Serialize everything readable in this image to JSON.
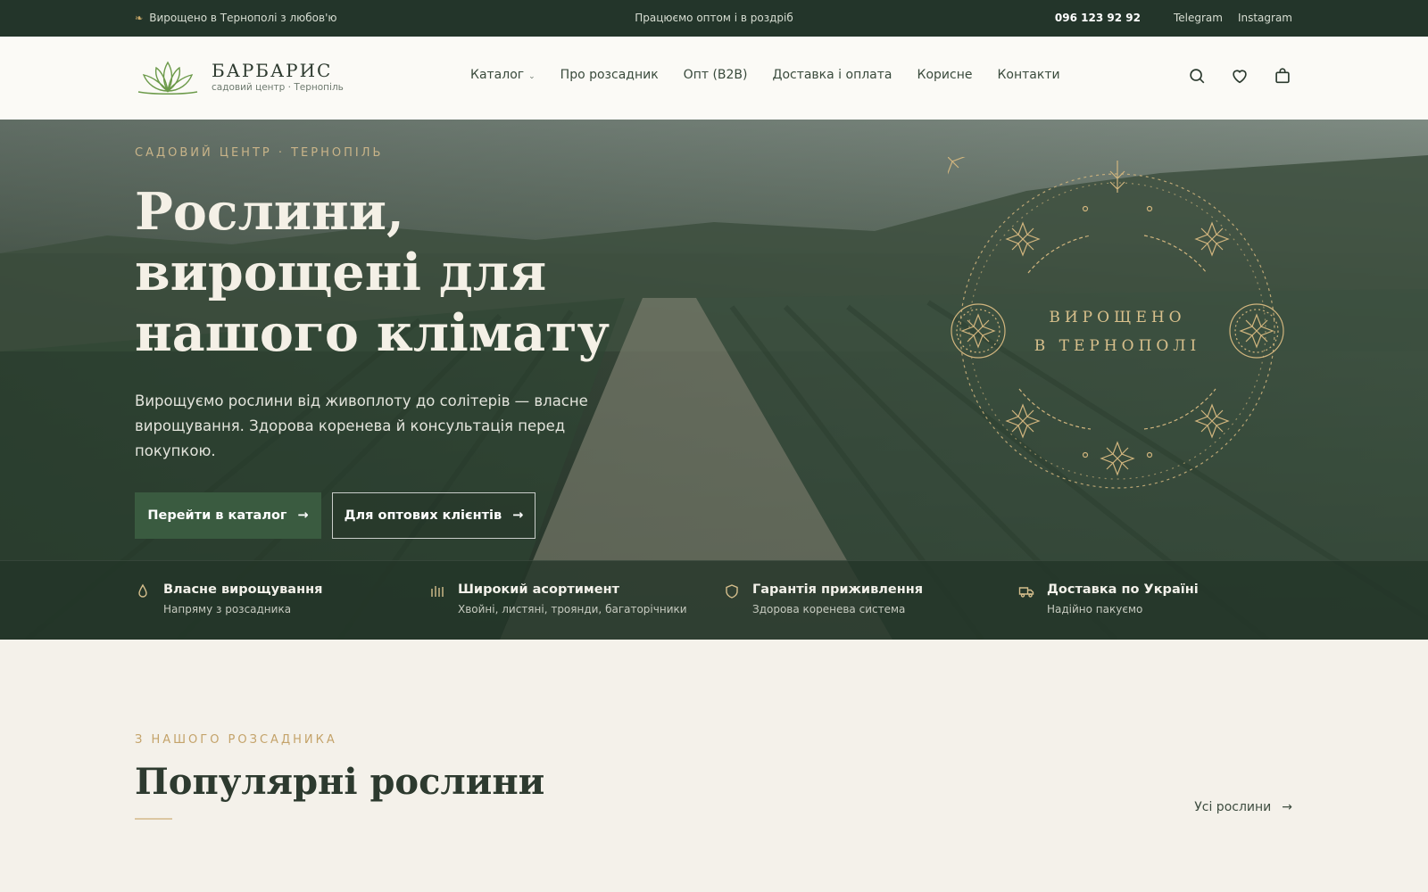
{
  "topbar": {
    "tagline": "Вирощено в Тернополі з любов'ю",
    "center": "Працюємо оптом і в роздріб",
    "phone": "096 123 92 92",
    "telegram": "Telegram",
    "instagram": "Instagram"
  },
  "header": {
    "brand_name": "БАРБАРИС",
    "brand_sub": "садовий центр · Тернопіль",
    "nav": [
      "Каталог",
      "Про розсадник",
      "Опт (B2B)",
      "Доставка і оплата",
      "Корисне",
      "Контакти"
    ],
    "icons": [
      "search-icon",
      "heart-icon",
      "bag-icon"
    ]
  },
  "hero": {
    "eyebrow": "САДОВИЙ ЦЕНТР · ТЕРНОПІЛЬ",
    "title_line1": "Рослини,",
    "title_line2": "вирощені для",
    "title_line3": "нашого клімату",
    "text": "Вирощуємо рослини від живоплоту до солітерів — власне вирощування. Здорова коренева й консультація перед покупкою.",
    "btn_primary": "Перейти в каталог",
    "btn_outline": "Для оптових клієнтів",
    "emblem_line1": "ВИРОЩЕНО",
    "emblem_line2": "В ТЕРНОПОЛІ"
  },
  "features": [
    {
      "title": "Власне вирощування",
      "sub": "Напряму з розсадника",
      "icon": "drop-icon"
    },
    {
      "title": "Широкий асортимент",
      "sub": "Хвойні, листяні, троянди, багаторічники",
      "icon": "bars-icon"
    },
    {
      "title": "Гарантія приживлення",
      "sub": "Здорова коренева система",
      "icon": "shield-icon"
    },
    {
      "title": "Доставка по Україні",
      "sub": "Надійно пакуємо",
      "icon": "truck-icon"
    }
  ],
  "section": {
    "eyebrow": "З НАШОГО РОЗСАДНИКА",
    "title": "Популярні рослини",
    "link": "Усі рослини"
  },
  "colors": {
    "topbar": "#23352a",
    "accent_green": "#3a5b40",
    "gold": "#c9a868",
    "page_bg": "#f4f1ea"
  }
}
